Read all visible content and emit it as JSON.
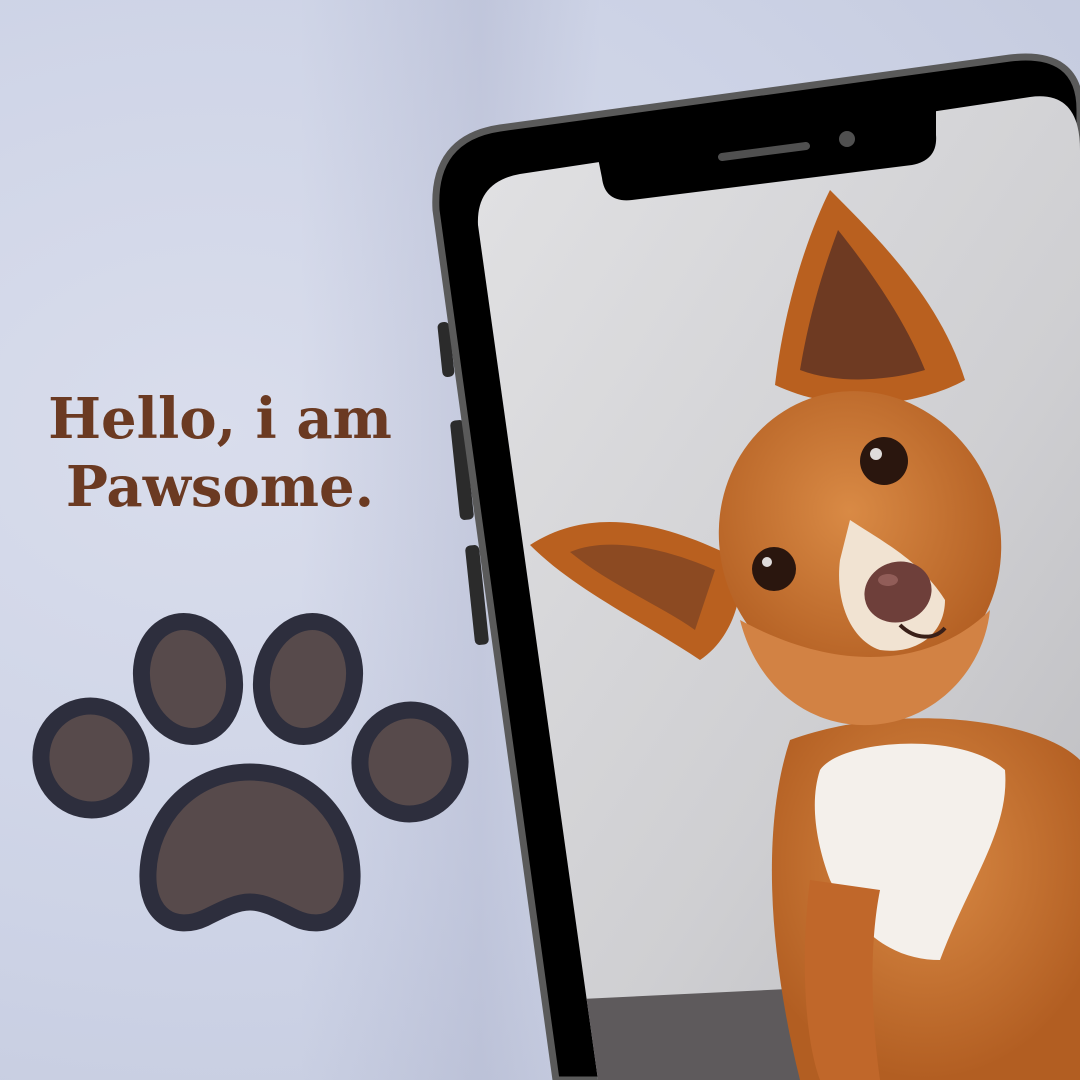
{
  "headline": {
    "line1": "Hello, i am",
    "line2": "Pawsome."
  },
  "icons": {
    "paw": "paw-print-icon"
  },
  "colors": {
    "background": "#cfd4e7",
    "headline": "#6b3a22",
    "paw_fill": "#574a4b",
    "paw_outline": "#2d2e3d",
    "phone_frame": "#000000",
    "dog_fur": "#c8702e"
  }
}
